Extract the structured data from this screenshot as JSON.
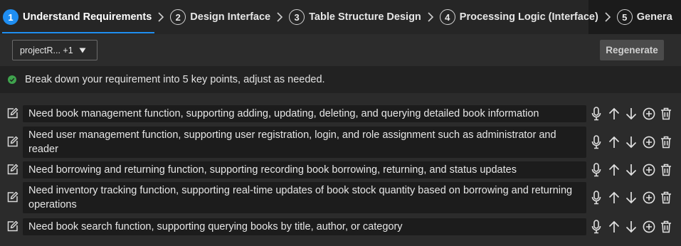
{
  "steps": [
    {
      "num": "1",
      "label": "Understand Requirements"
    },
    {
      "num": "2",
      "label": "Design Interface"
    },
    {
      "num": "3",
      "label": "Table Structure Design"
    },
    {
      "num": "4",
      "label": "Processing Logic (Interface)"
    },
    {
      "num": "5",
      "label": "Genera"
    }
  ],
  "active_step": 1,
  "toolbar": {
    "select_value": "projectR... +1",
    "regenerate_label": "Regenerate"
  },
  "info": {
    "message": "Break down your requirement into 5 key points, adjust as needed."
  },
  "requirements": [
    "Need book management function, supporting adding, updating, deleting, and querying detailed book information",
    "Need user management function, supporting user registration, login, and role assignment such as administrator and reader",
    "Need borrowing and returning function, supporting recording book borrowing, returning, and status updates",
    "Need inventory tracking function, supporting real-time updates of book stock quantity based on borrowing and returning operations",
    "Need book search function, supporting querying books by title, author, or category"
  ],
  "colors": {
    "accent": "#1f8ef1",
    "success": "#3fa34d",
    "background": "#2b2b2b",
    "text_box": "#1c1c1c"
  },
  "icons": [
    "edit-icon",
    "microphone-icon",
    "arrow-up-icon",
    "arrow-down-icon",
    "add-circle-icon",
    "trash-icon",
    "chevron-right-icon",
    "check-circle-icon",
    "caret-down-icon"
  ]
}
